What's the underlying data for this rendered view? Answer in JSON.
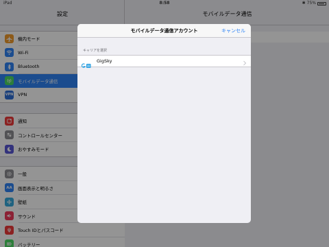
{
  "status_bar": {
    "device": "iPad",
    "time": "8:58",
    "battery": "75%"
  },
  "sidebar": {
    "title": "設定",
    "groups": [
      {
        "items": [
          {
            "label": "機内モード",
            "icon": "airplane-icon",
            "color": "#f29b2b"
          },
          {
            "label": "Wi-Fi",
            "icon": "wifi-icon",
            "color": "#2f83f5"
          },
          {
            "label": "Bluetooth",
            "icon": "bluetooth-icon",
            "color": "#2f83f5"
          },
          {
            "label": "モバイルデータ通信",
            "icon": "cellular-icon",
            "color": "#4cd964",
            "selected": true
          },
          {
            "label": "VPN",
            "icon": "vpn-icon",
            "color": "#2f6fd6"
          }
        ]
      },
      {
        "items": [
          {
            "label": "通知",
            "icon": "notifications-icon",
            "color": "#f03a3a"
          },
          {
            "label": "コントロールセンター",
            "icon": "control-center-icon",
            "color": "#8e8e93"
          },
          {
            "label": "おやすみモード",
            "icon": "moon-icon",
            "color": "#5856d6"
          }
        ]
      },
      {
        "items": [
          {
            "label": "一般",
            "icon": "gear-icon",
            "color": "#8e8e93"
          },
          {
            "label": "画面表示と明るさ",
            "icon": "brightness-icon",
            "color": "#2f83f5"
          },
          {
            "label": "壁紙",
            "icon": "wallpaper-icon",
            "color": "#35aadc"
          },
          {
            "label": "サウンド",
            "icon": "sound-icon",
            "color": "#f03a5a"
          },
          {
            "label": "Touch IDとパスコード",
            "icon": "fingerprint-icon",
            "color": "#f03a3a"
          },
          {
            "label": "バッテリー",
            "icon": "battery-icon",
            "color": "#4cd964"
          }
        ]
      }
    ]
  },
  "detail": {
    "title": "モバイルデータ通信"
  },
  "modal": {
    "title": "モバイルデータ通信アカウント",
    "cancel_label": "キャンセル",
    "section_header": "キャリアを選択",
    "carrier": {
      "name": "GigSky",
      "logo": "gigsky-logo-icon"
    }
  }
}
